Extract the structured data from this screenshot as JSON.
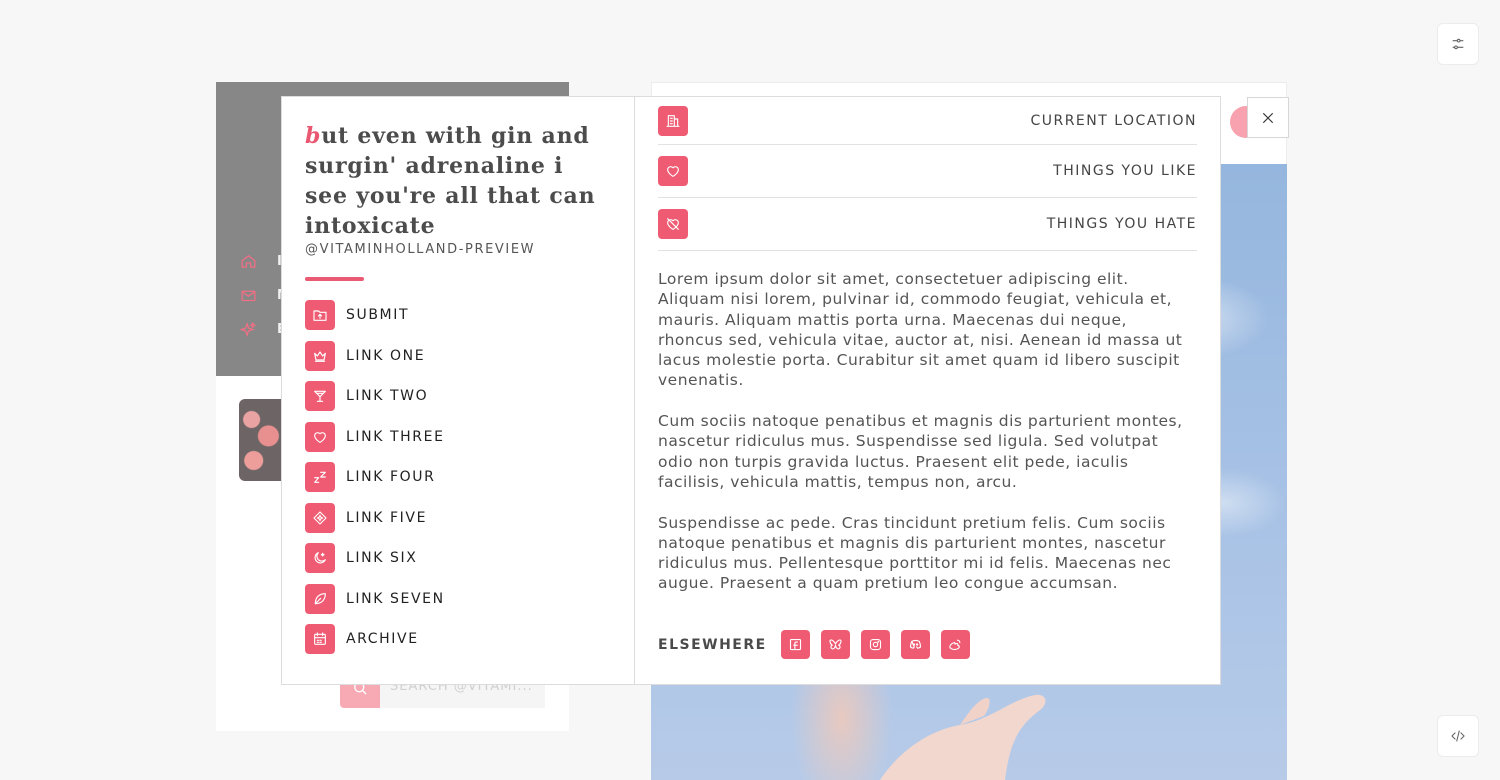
{
  "background": {
    "search_placeholder": "SEARCH @VITAMI...",
    "nav": [
      {
        "icon": "home-icon",
        "label": "I"
      },
      {
        "icon": "mail-icon",
        "label": "M"
      },
      {
        "icon": "sparkle-icon",
        "label": "E"
      }
    ]
  },
  "modal": {
    "quote_first_letter": "b",
    "quote_rest": "ut even with gin and surgin' adrenaline i see you're all that can intoxicate",
    "handle": "@VITAMINHOLLAND-PREVIEW",
    "menu": [
      {
        "icon": "upload-folder-icon",
        "label": "SUBMIT"
      },
      {
        "icon": "crown-icon",
        "label": "LINK ONE"
      },
      {
        "icon": "cocktail-icon",
        "label": "LINK TWO"
      },
      {
        "icon": "heart-icon",
        "label": "LINK THREE"
      },
      {
        "icon": "sleep-icon",
        "label": "LINK FOUR"
      },
      {
        "icon": "diamond-star-icon",
        "label": "LINK FIVE"
      },
      {
        "icon": "moon-icon",
        "label": "LINK SIX"
      },
      {
        "icon": "leaf-icon",
        "label": "LINK SEVEN"
      },
      {
        "icon": "calendar-icon",
        "label": "ARCHIVE"
      }
    ],
    "info_rows": [
      {
        "icon": "building-icon",
        "label": "CURRENT LOCATION"
      },
      {
        "icon": "heart-icon",
        "label": "THINGS YOU LIKE"
      },
      {
        "icon": "heart-crossed-icon",
        "label": "THINGS YOU HATE"
      }
    ],
    "paragraphs": [
      "Lorem ipsum dolor sit amet, consectetuer adipiscing elit. Aliquam nisi lorem, pulvinar id, commodo feugiat, vehicula et, mauris. Aliquam mattis porta urna. Maecenas dui neque, rhoncus sed, vehicula vitae, auctor at, nisi. Aenean id massa ut lacus molestie porta. Curabitur sit amet quam id libero suscipit venenatis.",
      "Cum sociis natoque penatibus et magnis dis parturient montes, nascetur ridiculus mus. Suspendisse sed ligula. Sed volutpat odio non turpis gravida luctus. Praesent elit pede, iaculis facilisis, vehicula mattis, tempus non, arcu.",
      "Suspendisse ac pede. Cras tincidunt pretium felis. Cum sociis natoque penatibus et magnis dis parturient montes, nascetur ridiculus mus. Pellentesque porttitor mi id felis. Maecenas nec augue. Praesent a quam pretium leo congue accumsan."
    ],
    "elsewhere_label": "ELSEWHERE",
    "socials": [
      "facebook-icon",
      "butterfly-icon",
      "instagram-icon",
      "discord-icon",
      "weibo-icon"
    ]
  },
  "colors": {
    "accent": "#ee5b72",
    "modal_border": "#dcdcdc",
    "background": "#f7f7f7"
  }
}
